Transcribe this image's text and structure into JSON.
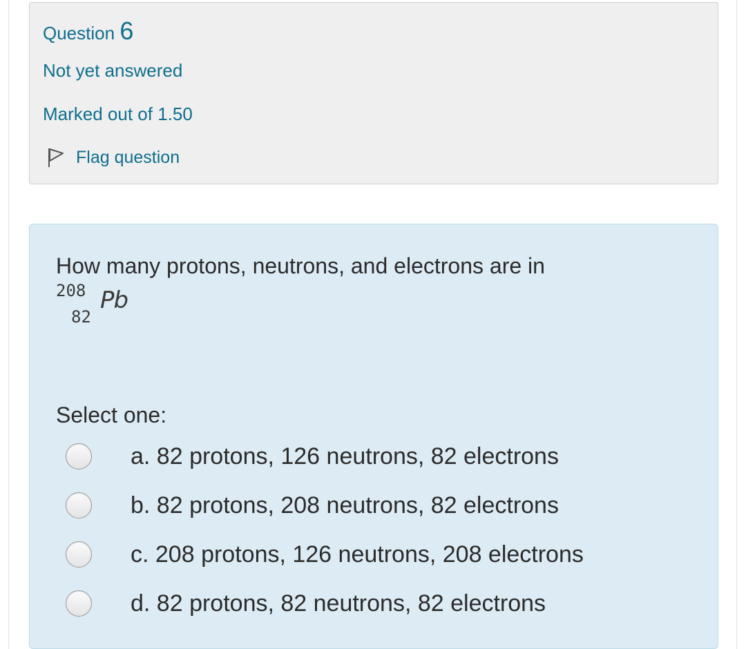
{
  "question_info": {
    "prefix": "Question",
    "number": "6",
    "state": "Not yet answered",
    "grade": "Marked out of 1.50",
    "flag_label": "Flag question",
    "flag_icon": "flag-icon"
  },
  "question": {
    "text": "How many protons, neutrons, and electrons are in",
    "formula": {
      "mass_number": "208",
      "atomic_number": "82",
      "element": "Pb"
    },
    "prompt": "Select one:",
    "answers": [
      {
        "label": "a. 82 protons, 126 neutrons, 82 electrons",
        "selected": false
      },
      {
        "label": "b. 82 protons, 208 neutrons, 82 electrons",
        "selected": false
      },
      {
        "label": "c. 208 protons, 126 neutrons, 208 electrons",
        "selected": false
      },
      {
        "label": "d. 82 protons, 82 neutrons, 82 electrons",
        "selected": false
      }
    ]
  },
  "colors": {
    "accent_text": "#0f6e8c",
    "info_bg": "#efefef",
    "question_bg": "#dcebf4"
  }
}
